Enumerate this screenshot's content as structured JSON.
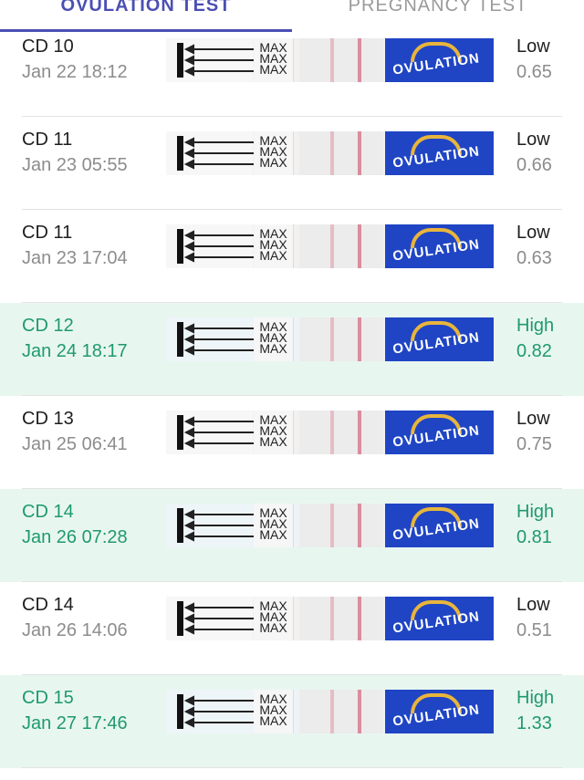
{
  "tabs": {
    "ovulation": "OVULATION TEST",
    "pregnancy": "PREGNANCY TEST",
    "active": "ovulation"
  },
  "strip_text": {
    "max": "MAX",
    "brand": "OVULATION"
  },
  "colors": {
    "accent": "#4a4fb3",
    "high_text": "#1f9a6c",
    "high_row_bg": "#e8f6f0",
    "brand_blue": "#1f45c4",
    "test_line": "#d88d9c"
  },
  "results": [
    {
      "cycle_day": "CD 10",
      "timestamp": "Jan 22 18:12",
      "level": "Low",
      "value": "0.65",
      "high": false
    },
    {
      "cycle_day": "CD 11",
      "timestamp": "Jan 23 05:55",
      "level": "Low",
      "value": "0.66",
      "high": false
    },
    {
      "cycle_day": "CD 11",
      "timestamp": "Jan 23 17:04",
      "level": "Low",
      "value": "0.63",
      "high": false
    },
    {
      "cycle_day": "CD 12",
      "timestamp": "Jan 24 18:17",
      "level": "High",
      "value": "0.82",
      "high": true
    },
    {
      "cycle_day": "CD 13",
      "timestamp": "Jan 25 06:41",
      "level": "Low",
      "value": "0.75",
      "high": false
    },
    {
      "cycle_day": "CD 14",
      "timestamp": "Jan 26 07:28",
      "level": "High",
      "value": "0.81",
      "high": true
    },
    {
      "cycle_day": "CD 14",
      "timestamp": "Jan 26 14:06",
      "level": "Low",
      "value": "0.51",
      "high": false
    },
    {
      "cycle_day": "CD 15",
      "timestamp": "Jan 27 17:46",
      "level": "High",
      "value": "1.33",
      "high": true
    }
  ]
}
